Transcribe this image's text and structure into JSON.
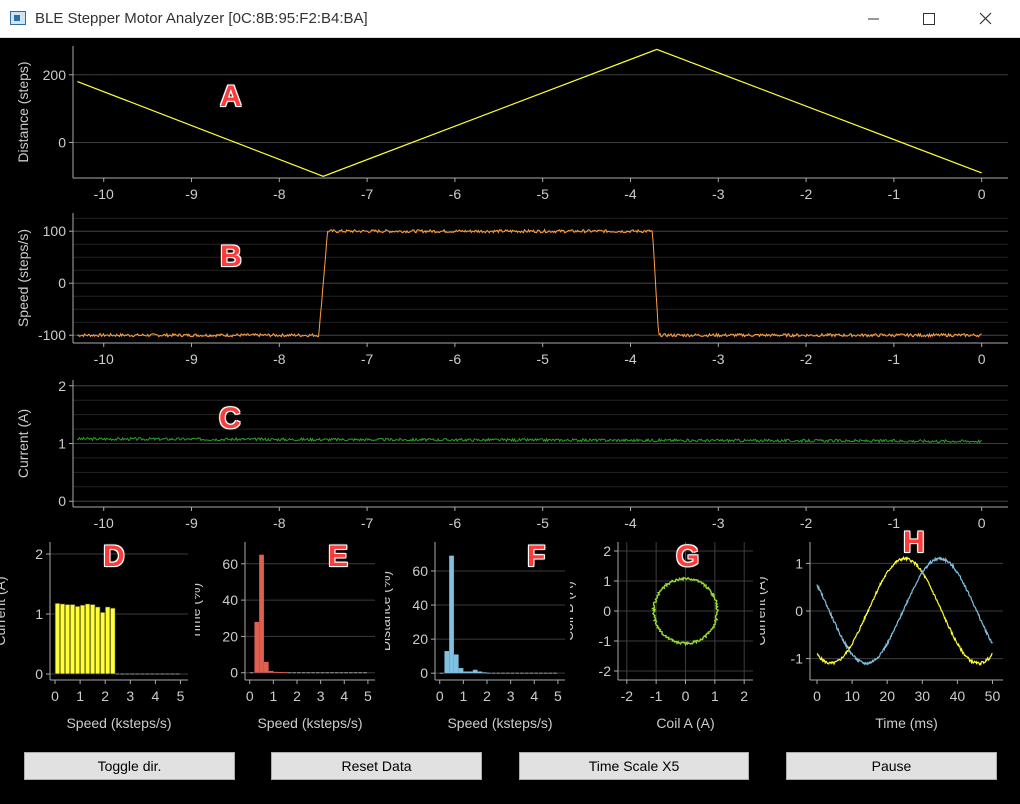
{
  "window": {
    "title": "BLE Stepper Motor Analyzer [0C:8B:95:F2:B4:BA]"
  },
  "plot_letters": [
    "A",
    "B",
    "C",
    "D",
    "E",
    "F",
    "G",
    "H"
  ],
  "buttons": {
    "toggle_dir": "Toggle dir.",
    "reset_data": "Reset Data",
    "time_scale": "Time Scale X5",
    "pause": "Pause"
  },
  "colors": {
    "background": "#000000",
    "grid": "#3a3a3a",
    "axis_text": "#cccccc",
    "yellow": "#ffff33",
    "orange": "#ffa040",
    "green": "#2ca02c",
    "red": "#e06050",
    "blue": "#80c0e0",
    "lime": "#99dd33"
  },
  "chart_data": [
    {
      "id": "A",
      "type": "line",
      "xlabel": "",
      "ylabel": "Distance (steps)",
      "xlim": [
        -10.35,
        0.3
      ],
      "ylim": [
        -105,
        285
      ],
      "xticks": [
        "-10",
        "-9",
        "-8",
        "-7",
        "-6",
        "-5",
        "-4",
        "-3",
        "-2",
        "-1",
        "0"
      ],
      "yticks": [
        "0",
        "200"
      ],
      "series": [
        {
          "x": [
            -10.3,
            -7.5,
            -3.7,
            0
          ],
          "y": [
            180,
            -100,
            275,
            -90
          ]
        }
      ]
    },
    {
      "id": "B",
      "type": "line",
      "xlabel": "",
      "ylabel": "Speed (steps/s)",
      "xlim": [
        -10.35,
        0.3
      ],
      "ylim": [
        -115,
        135
      ],
      "xticks": [
        "-10",
        "-9",
        "-8",
        "-7",
        "-6",
        "-5",
        "-4",
        "-3",
        "-2",
        "-1",
        "0"
      ],
      "yticks": [
        "-100",
        "0",
        "100"
      ],
      "series": [
        {
          "x": [
            -10.3,
            -7.55,
            -7.45,
            -3.75,
            -3.68,
            0
          ],
          "y": [
            -100,
            -100,
            100,
            100,
            -100,
            -100
          ]
        }
      ]
    },
    {
      "id": "C",
      "type": "line",
      "xlabel": "",
      "ylabel": "Current (A)",
      "xlim": [
        -10.35,
        0.3
      ],
      "ylim": [
        -0.1,
        2.1
      ],
      "xticks": [
        "-10",
        "-9",
        "-8",
        "-7",
        "-6",
        "-5",
        "-4",
        "-3",
        "-2",
        "-1",
        "0"
      ],
      "yticks": [
        "0",
        "1",
        "2"
      ],
      "series": [
        {
          "x": [
            -10.3,
            0
          ],
          "y": [
            1.08,
            1.04
          ]
        }
      ]
    },
    {
      "id": "D",
      "type": "bar",
      "xlabel": "Speed (ksteps/s)",
      "ylabel": "Current (A)",
      "xlim": [
        -0.2,
        5.3
      ],
      "ylim": [
        -0.1,
        2.2
      ],
      "xticks": [
        "0",
        "1",
        "2",
        "3",
        "4",
        "5"
      ],
      "yticks": [
        "0",
        "1",
        "2"
      ],
      "bin_width": 0.2,
      "values": [
        1.18,
        1.17,
        1.16,
        1.16,
        1.13,
        1.15,
        1.17,
        1.16,
        1.12,
        1.03,
        1.12,
        1.1,
        0,
        0,
        0,
        0,
        0,
        0,
        0,
        0,
        0,
        0,
        0,
        0,
        0
      ]
    },
    {
      "id": "E",
      "type": "bar",
      "xlabel": "Speed (ksteps/s)",
      "ylabel": "Time (%)",
      "xlim": [
        -0.2,
        5.3
      ],
      "ylim": [
        -4,
        72
      ],
      "xticks": [
        "0",
        "1",
        "2",
        "3",
        "4",
        "5"
      ],
      "yticks": [
        "0",
        "20",
        "40",
        "60"
      ],
      "bin_width": 0.2,
      "values": [
        0,
        28,
        65,
        6,
        1,
        0.5,
        0.4,
        0.3,
        0,
        0,
        0,
        0,
        0,
        0,
        0,
        0,
        0,
        0,
        0,
        0,
        0,
        0,
        0,
        0,
        0
      ]
    },
    {
      "id": "F",
      "type": "bar",
      "xlabel": "Speed (ksteps/s)",
      "ylabel": "Distance (%)",
      "xlim": [
        -0.2,
        5.3
      ],
      "ylim": [
        -4,
        77
      ],
      "xticks": [
        "0",
        "1",
        "2",
        "3",
        "4",
        "5"
      ],
      "yticks": [
        "0",
        "20",
        "40",
        "60"
      ],
      "bin_width": 0.2,
      "values": [
        0,
        13,
        69,
        11,
        3,
        1,
        1,
        2,
        1,
        0.5,
        0,
        0,
        0,
        0,
        0,
        0,
        0,
        0,
        0,
        0,
        0,
        0,
        0,
        0,
        0
      ]
    },
    {
      "id": "G",
      "type": "scatter",
      "xlabel": "Coil A (A)",
      "ylabel": "Coil B (A)",
      "xlim": [
        -2.3,
        2.3
      ],
      "ylim": [
        -2.3,
        2.3
      ],
      "xticks": [
        "-2",
        "-1",
        "0",
        "1",
        "2"
      ],
      "yticks": [
        "-2",
        "-1",
        "0",
        "1",
        "2"
      ],
      "series": [
        {
          "shape": "circle",
          "radius": 1.08
        }
      ]
    },
    {
      "id": "H",
      "type": "line",
      "xlabel": "Time (ms)",
      "ylabel": "Current (A)",
      "xlim": [
        -2,
        53
      ],
      "ylim": [
        -1.45,
        1.45
      ],
      "xticks": [
        "0",
        "10",
        "20",
        "30",
        "40",
        "50"
      ],
      "yticks": [
        "-1",
        "0",
        "1"
      ],
      "series": [
        {
          "color": "yellow",
          "amplitude": 1.1,
          "period_ms": 42,
          "phase_ms": 25
        },
        {
          "color": "blue",
          "amplitude": 1.1,
          "period_ms": 42,
          "phase_ms": 35
        }
      ]
    }
  ]
}
